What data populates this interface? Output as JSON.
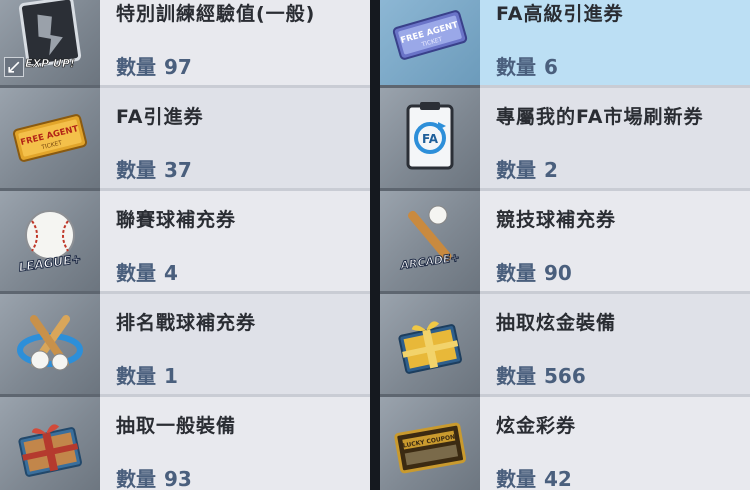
{
  "quantity_label": "數量",
  "left_items": [
    {
      "name": "特別訓練經驗值(一般)",
      "qty": "97",
      "icon": "exp-up-card-icon",
      "badge": "EXP UP!"
    },
    {
      "name": "FA引進券",
      "qty": "37",
      "icon": "free-agent-ticket-icon",
      "badge": "FREE AGENT"
    },
    {
      "name": "聯賽球補充券",
      "qty": "4",
      "icon": "league-ball-icon",
      "badge": "LEAGUE+"
    },
    {
      "name": "排名戰球補充券",
      "qty": "1",
      "icon": "ranking-bats-ball-icon"
    },
    {
      "name": "抽取一般裝備",
      "qty": "93",
      "icon": "equipment-box-icon"
    }
  ],
  "right_items": [
    {
      "name": "FA高級引進券",
      "qty": "6",
      "icon": "premium-free-agent-ticket-icon",
      "badge": "FREE AGENT"
    },
    {
      "name": "專屬我的FA市場刷新券",
      "qty": "2",
      "icon": "fa-refresh-card-icon",
      "badge": "FA"
    },
    {
      "name": "競技球補充券",
      "qty": "90",
      "icon": "arcade-bat-ball-icon",
      "badge": "ARCADE+"
    },
    {
      "name": "抽取炫金裝備",
      "qty": "566",
      "icon": "gold-equipment-box-icon"
    },
    {
      "name": "炫金彩券",
      "qty": "42",
      "icon": "lucky-coupon-icon",
      "badge": "LUCKY COUPON"
    }
  ],
  "colors": {
    "selected_border": "#3aa6e6",
    "quantity_text": "#4a5f7d"
  }
}
